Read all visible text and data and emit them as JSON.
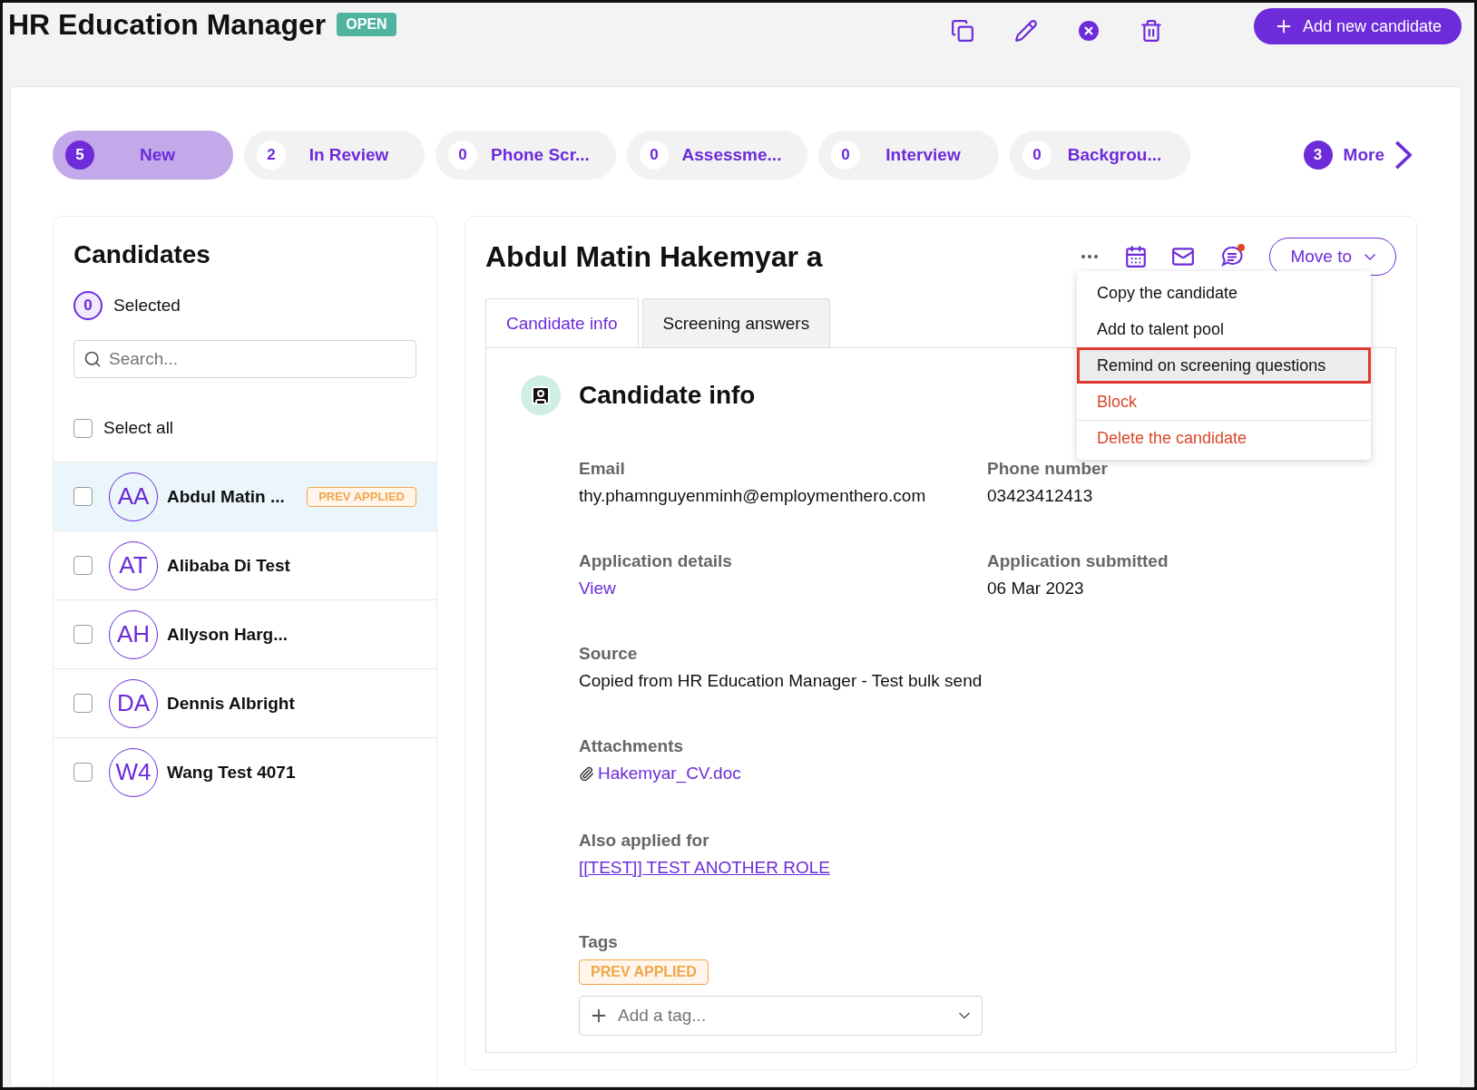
{
  "header": {
    "title": "HR Education Manager",
    "status": "OPEN",
    "add_button": "Add new candidate"
  },
  "stages": [
    {
      "count": "5",
      "label": "New",
      "selected": true
    },
    {
      "count": "2",
      "label": "In Review",
      "selected": false
    },
    {
      "count": "0",
      "label": "Phone Scr...",
      "selected": false
    },
    {
      "count": "0",
      "label": "Assessme...",
      "selected": false
    },
    {
      "count": "0",
      "label": "Interview",
      "selected": false
    },
    {
      "count": "0",
      "label": "Backgrou...",
      "selected": false
    }
  ],
  "more": {
    "count": "3",
    "label": "More"
  },
  "candidates": {
    "title": "Candidates",
    "selected_count": "0",
    "selected_label": "Selected",
    "search": {
      "placeholder": "Search..."
    },
    "select_all": {
      "label": "Select all",
      "checked": false
    },
    "rows": [
      {
        "initials": "AA",
        "name": "Abdul Matin ...",
        "badge": "PREV APPLIED",
        "selected": true,
        "checked": false
      },
      {
        "initials": "AT",
        "name": "Alibaba Di Test",
        "selected": false,
        "checked": false
      },
      {
        "initials": "AH",
        "name": "Allyson Harg...",
        "selected": false,
        "checked": false
      },
      {
        "initials": "DA",
        "name": "Dennis Albright",
        "selected": false,
        "checked": false
      },
      {
        "initials": "W4",
        "name": "Wang Test 4071",
        "selected": false,
        "checked": false
      }
    ]
  },
  "detail": {
    "name": "Abdul Matin Hakemyar a",
    "move_button": "Move to",
    "menu": [
      {
        "label": "Copy the candidate",
        "kind": "normal",
        "highlighted": false
      },
      {
        "label": "Add to talent pool",
        "kind": "normal",
        "highlighted": false
      },
      {
        "label": "Remind on screening questions",
        "kind": "normal",
        "highlighted": true
      },
      {
        "label": "Block",
        "kind": "danger",
        "highlighted": false
      },
      {
        "label": "Delete the candidate",
        "kind": "danger",
        "highlighted": false
      }
    ],
    "tabs": [
      {
        "label": "Candidate info",
        "selected": true
      },
      {
        "label": "Screening answers",
        "selected": false
      }
    ],
    "section_title": "Candidate info",
    "field_rows": [
      [
        {
          "label": "Email",
          "value": "thy.phamnguyenminh@employmenthero.com",
          "kind": "text"
        },
        {
          "label": "Phone number",
          "value": "03423412413",
          "kind": "text"
        }
      ],
      [
        {
          "label": "Application details",
          "value": "View",
          "kind": "link"
        },
        {
          "label": "Application submitted",
          "value": "06 Mar 2023",
          "kind": "text"
        }
      ],
      [
        {
          "label": "Source",
          "value": "Copied from HR Education Manager - Test bulk send",
          "kind": "text"
        }
      ],
      [
        {
          "label": "Attachments",
          "value": "Hakemyar_CV.doc",
          "kind": "attachment"
        }
      ],
      [
        {
          "label": "Also applied for",
          "value": "[[TEST]] TEST ANOTHER ROLE",
          "kind": "role"
        }
      ]
    ],
    "tags_label": "Tags",
    "tags": [
      "PREV APPLIED"
    ],
    "add_tag": {
      "placeholder": "Add a tag..."
    }
  }
}
